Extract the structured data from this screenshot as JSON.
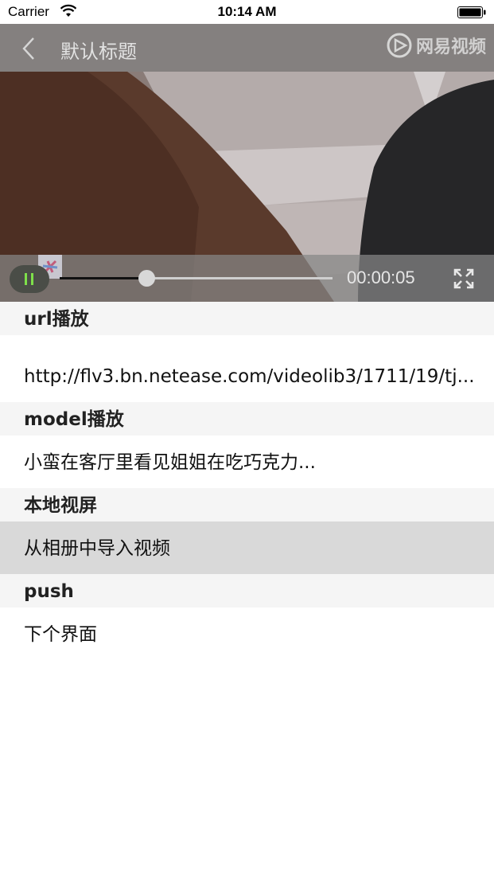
{
  "status_bar": {
    "carrier": "Carrier",
    "time": "10:14 AM"
  },
  "player": {
    "title": "默认标题",
    "watermark": "网易视频",
    "current_time": "00:00:05",
    "progress": 0.32,
    "state": "playing",
    "icons": {
      "back": "chevron-left-icon",
      "pause": "pause-icon",
      "fullscreen": "fullscreen-icon",
      "logo": "netease-video-logo"
    }
  },
  "sections": [
    {
      "header": "url播放",
      "row": "http://flv3.bn.netease.com/videolib3/1711/19/tj..."
    },
    {
      "header": "model播放",
      "row": "小蛮在客厅里看见姐姐在吃巧克力..."
    },
    {
      "header": "本地视屏",
      "row": "从相册中导入视频"
    },
    {
      "header": "push",
      "row": "下个界面"
    }
  ],
  "colors": {
    "header_bg": "#f5f5f5",
    "selected_row_bg": "#d9d9d9",
    "play_icon": "#7ee04a"
  }
}
